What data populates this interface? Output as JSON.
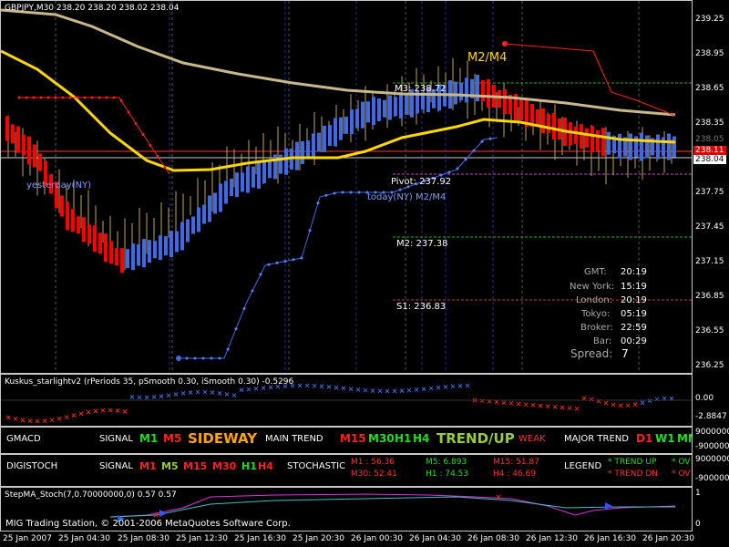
{
  "main_chart": {
    "title": "GBPJPY,M30  238.20 238.20 238.02 238.04",
    "price_scale": [
      "239.25",
      "238.95",
      "238.65",
      "238.35",
      "238.05",
      "237.75",
      "237.45",
      "237.15",
      "236.85",
      "236.55",
      "236.25"
    ],
    "current_price_red": "238.11",
    "current_price": "238.04",
    "annotations": {
      "m2m4": "M2/M4",
      "m3": "M3: 238.72",
      "pivot": "Pivot: 237.92",
      "today": "today(NY) M2/M4",
      "yesterday": "yesterday(NY)",
      "m2": "M2: 237.38",
      "s1": "S1: 236.83"
    },
    "clock": {
      "gmt_label": "GMT:",
      "gmt": "20:19",
      "ny_label": "New York:",
      "ny": "15:19",
      "london_label": "London:",
      "london": "20:19",
      "tokyo_label": "Tokyo:",
      "tokyo": "05:19",
      "broker_label": "Broker:",
      "broker": "22:59",
      "bar_label": "Bar:",
      "bar": "00:29",
      "spread_label": "Spread:",
      "spread": "7"
    }
  },
  "kuskus": {
    "title": "Kuskus_starlightv2  (rPeriods 35, pSmooth 0.30, iSmooth 0.30)  -0.5296",
    "scale": [
      "0.00",
      "-2.8847"
    ]
  },
  "gmacd": {
    "name": "GMACD",
    "signal_label": "SIGNAL",
    "m1": "M1",
    "m5": "M5",
    "state": "SIDEWAY",
    "main_trend_label": "MAIN TREND",
    "m15": "M15",
    "m30": "M30",
    "h1": "H1",
    "h4": "H4",
    "trend": "TREND/UP",
    "strength": "WEAK",
    "major_trend_label": "MAJOR TREND",
    "d1": "D1",
    "w1": "W1",
    "mn": "MN",
    "scale": [
      "9000000",
      "-9000000"
    ]
  },
  "digistoch": {
    "name": "DIGISTOCH",
    "signal_label": "SIGNAL",
    "m1": "M1",
    "m5": "M5",
    "m15": "M15",
    "m30": "M30",
    "h1": "H1",
    "h4": "H4",
    "stochastic_label": "STOCHASTIC",
    "v_m1": "M1  : 56.36",
    "v_m30": "M30: 52.41",
    "v_m5": "M5: 6.893",
    "v_h1": "H1 : 74.53",
    "v_m15": "M15: 51.87",
    "v_h4": "H4  : 46.69",
    "legend_label": "LEGEND",
    "legend_up": "* TREND UP",
    "legend_dn": "* TREND DN",
    "ov1": "* OV",
    "ov2": "* OV",
    "scale": [
      "9000000",
      "-9000000"
    ]
  },
  "stepma": {
    "title": "StepMA_Stoch(7,0.70000000,0) 0.57 0.57",
    "scale_top": "1",
    "scale_bottom": "0",
    "copyright": "MIG Trading Station, © 2001-2006 MetaQuotes Software Corp."
  },
  "time_axis": [
    "25 Jan 2007",
    "25 Jan 04:30",
    "25 Jan 08:30",
    "25 Jan 12:30",
    "25 Jan 16:30",
    "25 Jan 20:30",
    "26 Jan 00:30",
    "26 Jan 04:30",
    "26 Jan 08:30",
    "26 Jan 12:30",
    "26 Jan 16:30",
    "26 Jan 20:30"
  ],
  "colors": {
    "bull_bar": "#4169e1",
    "bear_bar": "#ff0000",
    "slow_ma": "#c8b98a",
    "fast_ma": "#ffd700",
    "pivot_line": "#ff3333",
    "m_line": "#22aa22",
    "candle": "#b8a36a"
  }
}
